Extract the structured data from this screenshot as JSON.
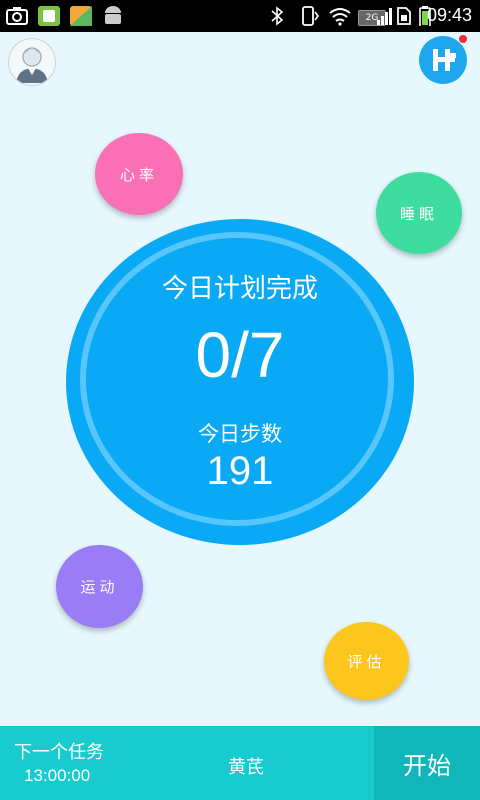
{
  "status_bar": {
    "time": "09:43",
    "network": "2G",
    "icons": [
      "screenshot-icon",
      "app-icon",
      "app-icon",
      "android-icon",
      "bluetooth-icon",
      "vibrate-icon",
      "wifi-icon",
      "signal-icon",
      "sim-icon",
      "battery-icon"
    ]
  },
  "header": {
    "avatar_icon": "user-avatar-icon",
    "badge_icon": "h-logo-icon",
    "badge_dot_color": "#ef2a3b"
  },
  "bubbles": {
    "heart_rate": "心率",
    "sleep": "睡眠",
    "sport": "运动",
    "evaluate": "评估"
  },
  "summary": {
    "title": "今日计划完成",
    "ratio": "0/7",
    "steps_label": "今日步数",
    "steps": "191"
  },
  "bottom_bar": {
    "next_task_label": "下一个任务",
    "next_task_time": "13:00:00",
    "task_name": "黄芪",
    "start_label": "开始"
  },
  "colors": {
    "background": "#e6f8fd",
    "main_circle": "#0aa9f5",
    "heart": "#fb6fb6",
    "sleep": "#3fdca0",
    "sport": "#9a7cf6",
    "evaluate": "#fdc61c",
    "bottom_bar": "#19cbcf",
    "start_button": "#10b6b9"
  }
}
